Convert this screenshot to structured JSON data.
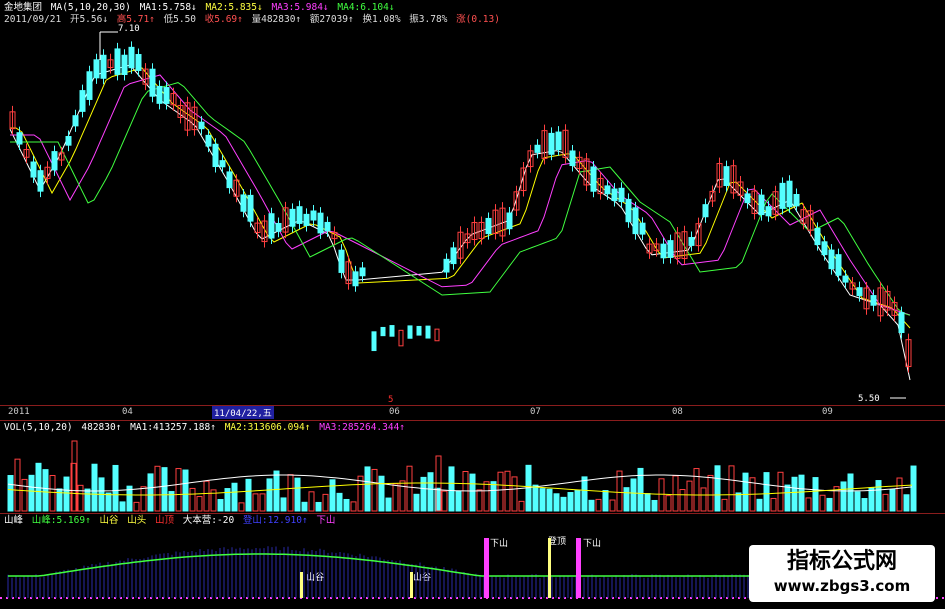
{
  "main": {
    "title": "金地集团",
    "ma_label": "MA(5,10,20,30)",
    "ma1": "MA1:5.758↓",
    "ma2": "MA2:5.835↓",
    "ma3": "MA3:5.984↓",
    "ma4": "MA4:6.104↓",
    "date": "2011/09/21",
    "open": "开5.56↓",
    "high": "高5.71↑",
    "low": "低5.50",
    "close": "收5.69↑",
    "volume": "量482830↑",
    "amount": "额27039↑",
    "turnover": "换1.08%",
    "amplitude": "振3.78%",
    "change": "涨(0.13)",
    "high_mark": "7.10",
    "low_mark": "5.50"
  },
  "time_axis": {
    "labels": [
      "2011",
      "04",
      "11/04/22,五",
      "06",
      "07",
      "08",
      "09"
    ],
    "marker": "5"
  },
  "volume": {
    "label": "VOL(5,10,20)",
    "value": "482830↑",
    "ma1": "MA1:413257.188↑",
    "ma2": "MA2:313606.094↑",
    "ma3": "MA3:285264.344↑"
  },
  "indicator": {
    "name": "山峰",
    "peak": "山峰:5.169↑",
    "valley": "山谷",
    "top": "山头",
    "summit": "山顶",
    "camp": "大本营:-20",
    "climb": "登山:12.910↑",
    "down": "下山",
    "annotations": [
      "下山",
      "登顶",
      "下山",
      "山谷",
      "山谷"
    ]
  },
  "watermark": {
    "title": "指标公式网",
    "url": "www.zbgs3.com"
  },
  "colors": {
    "up": "#ff4040",
    "down": "#54ffff",
    "ma1": "#ffffff",
    "ma2": "#ffff00",
    "ma3": "#ff40ff",
    "ma4": "#40ff40",
    "separator": "#8a1d1d"
  }
}
